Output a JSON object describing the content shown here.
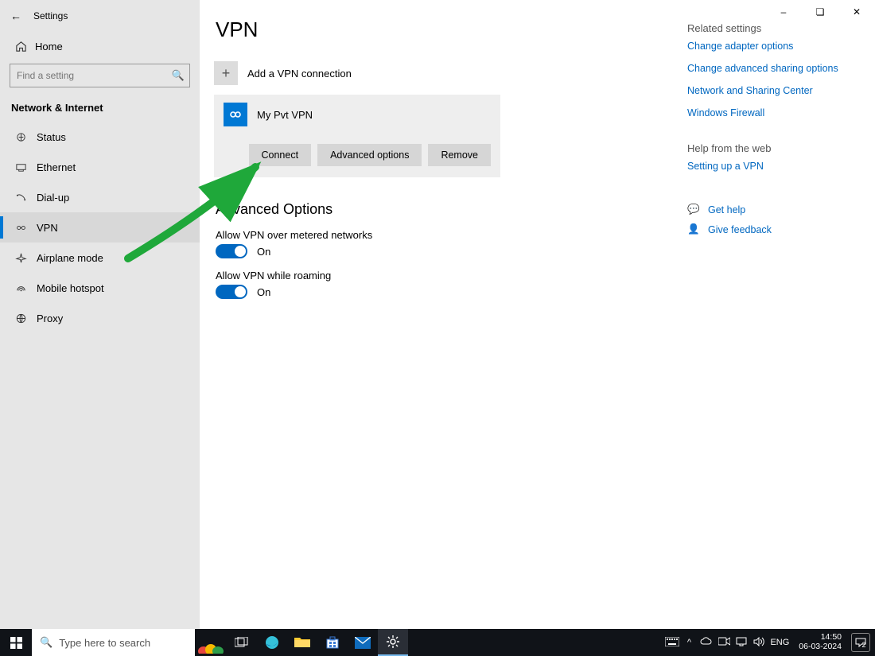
{
  "window": {
    "title": "Settings"
  },
  "sidebar": {
    "home": "Home",
    "search_placeholder": "Find a setting",
    "category": "Network & Internet",
    "items": [
      {
        "icon": "status",
        "label": "Status"
      },
      {
        "icon": "ethernet",
        "label": "Ethernet"
      },
      {
        "icon": "dialup",
        "label": "Dial-up"
      },
      {
        "icon": "vpn",
        "label": "VPN"
      },
      {
        "icon": "airplane",
        "label": "Airplane mode"
      },
      {
        "icon": "hotspot",
        "label": "Mobile hotspot"
      },
      {
        "icon": "proxy",
        "label": "Proxy"
      }
    ]
  },
  "page": {
    "title": "VPN",
    "add_label": "Add a VPN connection",
    "vpn_name": "My Pvt VPN",
    "connect_btn": "Connect",
    "adv_btn": "Advanced options",
    "remove_btn": "Remove",
    "adv_heading": "Advanced Options",
    "opt1_label": "Allow VPN over metered networks",
    "opt1_state": "On",
    "opt2_label": "Allow VPN while roaming",
    "opt2_state": "On"
  },
  "right": {
    "related_head": "Related settings",
    "links": [
      "Change adapter options",
      "Change advanced sharing options",
      "Network and Sharing Center",
      "Windows Firewall"
    ],
    "help_head": "Help from the web",
    "help_link": "Setting up a VPN",
    "get_help": "Get help",
    "feedback": "Give feedback"
  },
  "taskbar": {
    "search_placeholder": "Type here to search",
    "lang": "ENG",
    "time": "14:50",
    "date": "06-03-2024",
    "notif_count": "2"
  }
}
